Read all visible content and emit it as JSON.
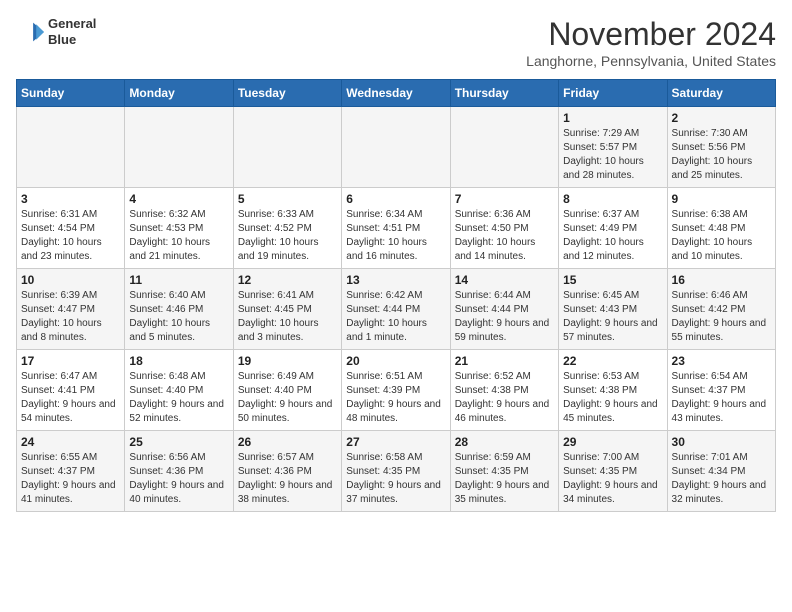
{
  "header": {
    "logo_line1": "General",
    "logo_line2": "Blue",
    "month_title": "November 2024",
    "location": "Langhorne, Pennsylvania, United States"
  },
  "weekdays": [
    "Sunday",
    "Monday",
    "Tuesday",
    "Wednesday",
    "Thursday",
    "Friday",
    "Saturday"
  ],
  "weeks": [
    [
      {
        "day": "",
        "info": ""
      },
      {
        "day": "",
        "info": ""
      },
      {
        "day": "",
        "info": ""
      },
      {
        "day": "",
        "info": ""
      },
      {
        "day": "",
        "info": ""
      },
      {
        "day": "1",
        "info": "Sunrise: 7:29 AM\nSunset: 5:57 PM\nDaylight: 10 hours and 28 minutes."
      },
      {
        "day": "2",
        "info": "Sunrise: 7:30 AM\nSunset: 5:56 PM\nDaylight: 10 hours and 25 minutes."
      }
    ],
    [
      {
        "day": "3",
        "info": "Sunrise: 6:31 AM\nSunset: 4:54 PM\nDaylight: 10 hours and 23 minutes."
      },
      {
        "day": "4",
        "info": "Sunrise: 6:32 AM\nSunset: 4:53 PM\nDaylight: 10 hours and 21 minutes."
      },
      {
        "day": "5",
        "info": "Sunrise: 6:33 AM\nSunset: 4:52 PM\nDaylight: 10 hours and 19 minutes."
      },
      {
        "day": "6",
        "info": "Sunrise: 6:34 AM\nSunset: 4:51 PM\nDaylight: 10 hours and 16 minutes."
      },
      {
        "day": "7",
        "info": "Sunrise: 6:36 AM\nSunset: 4:50 PM\nDaylight: 10 hours and 14 minutes."
      },
      {
        "day": "8",
        "info": "Sunrise: 6:37 AM\nSunset: 4:49 PM\nDaylight: 10 hours and 12 minutes."
      },
      {
        "day": "9",
        "info": "Sunrise: 6:38 AM\nSunset: 4:48 PM\nDaylight: 10 hours and 10 minutes."
      }
    ],
    [
      {
        "day": "10",
        "info": "Sunrise: 6:39 AM\nSunset: 4:47 PM\nDaylight: 10 hours and 8 minutes."
      },
      {
        "day": "11",
        "info": "Sunrise: 6:40 AM\nSunset: 4:46 PM\nDaylight: 10 hours and 5 minutes."
      },
      {
        "day": "12",
        "info": "Sunrise: 6:41 AM\nSunset: 4:45 PM\nDaylight: 10 hours and 3 minutes."
      },
      {
        "day": "13",
        "info": "Sunrise: 6:42 AM\nSunset: 4:44 PM\nDaylight: 10 hours and 1 minute."
      },
      {
        "day": "14",
        "info": "Sunrise: 6:44 AM\nSunset: 4:44 PM\nDaylight: 9 hours and 59 minutes."
      },
      {
        "day": "15",
        "info": "Sunrise: 6:45 AM\nSunset: 4:43 PM\nDaylight: 9 hours and 57 minutes."
      },
      {
        "day": "16",
        "info": "Sunrise: 6:46 AM\nSunset: 4:42 PM\nDaylight: 9 hours and 55 minutes."
      }
    ],
    [
      {
        "day": "17",
        "info": "Sunrise: 6:47 AM\nSunset: 4:41 PM\nDaylight: 9 hours and 54 minutes."
      },
      {
        "day": "18",
        "info": "Sunrise: 6:48 AM\nSunset: 4:40 PM\nDaylight: 9 hours and 52 minutes."
      },
      {
        "day": "19",
        "info": "Sunrise: 6:49 AM\nSunset: 4:40 PM\nDaylight: 9 hours and 50 minutes."
      },
      {
        "day": "20",
        "info": "Sunrise: 6:51 AM\nSunset: 4:39 PM\nDaylight: 9 hours and 48 minutes."
      },
      {
        "day": "21",
        "info": "Sunrise: 6:52 AM\nSunset: 4:38 PM\nDaylight: 9 hours and 46 minutes."
      },
      {
        "day": "22",
        "info": "Sunrise: 6:53 AM\nSunset: 4:38 PM\nDaylight: 9 hours and 45 minutes."
      },
      {
        "day": "23",
        "info": "Sunrise: 6:54 AM\nSunset: 4:37 PM\nDaylight: 9 hours and 43 minutes."
      }
    ],
    [
      {
        "day": "24",
        "info": "Sunrise: 6:55 AM\nSunset: 4:37 PM\nDaylight: 9 hours and 41 minutes."
      },
      {
        "day": "25",
        "info": "Sunrise: 6:56 AM\nSunset: 4:36 PM\nDaylight: 9 hours and 40 minutes."
      },
      {
        "day": "26",
        "info": "Sunrise: 6:57 AM\nSunset: 4:36 PM\nDaylight: 9 hours and 38 minutes."
      },
      {
        "day": "27",
        "info": "Sunrise: 6:58 AM\nSunset: 4:35 PM\nDaylight: 9 hours and 37 minutes."
      },
      {
        "day": "28",
        "info": "Sunrise: 6:59 AM\nSunset: 4:35 PM\nDaylight: 9 hours and 35 minutes."
      },
      {
        "day": "29",
        "info": "Sunrise: 7:00 AM\nSunset: 4:35 PM\nDaylight: 9 hours and 34 minutes."
      },
      {
        "day": "30",
        "info": "Sunrise: 7:01 AM\nSunset: 4:34 PM\nDaylight: 9 hours and 32 minutes."
      }
    ]
  ]
}
